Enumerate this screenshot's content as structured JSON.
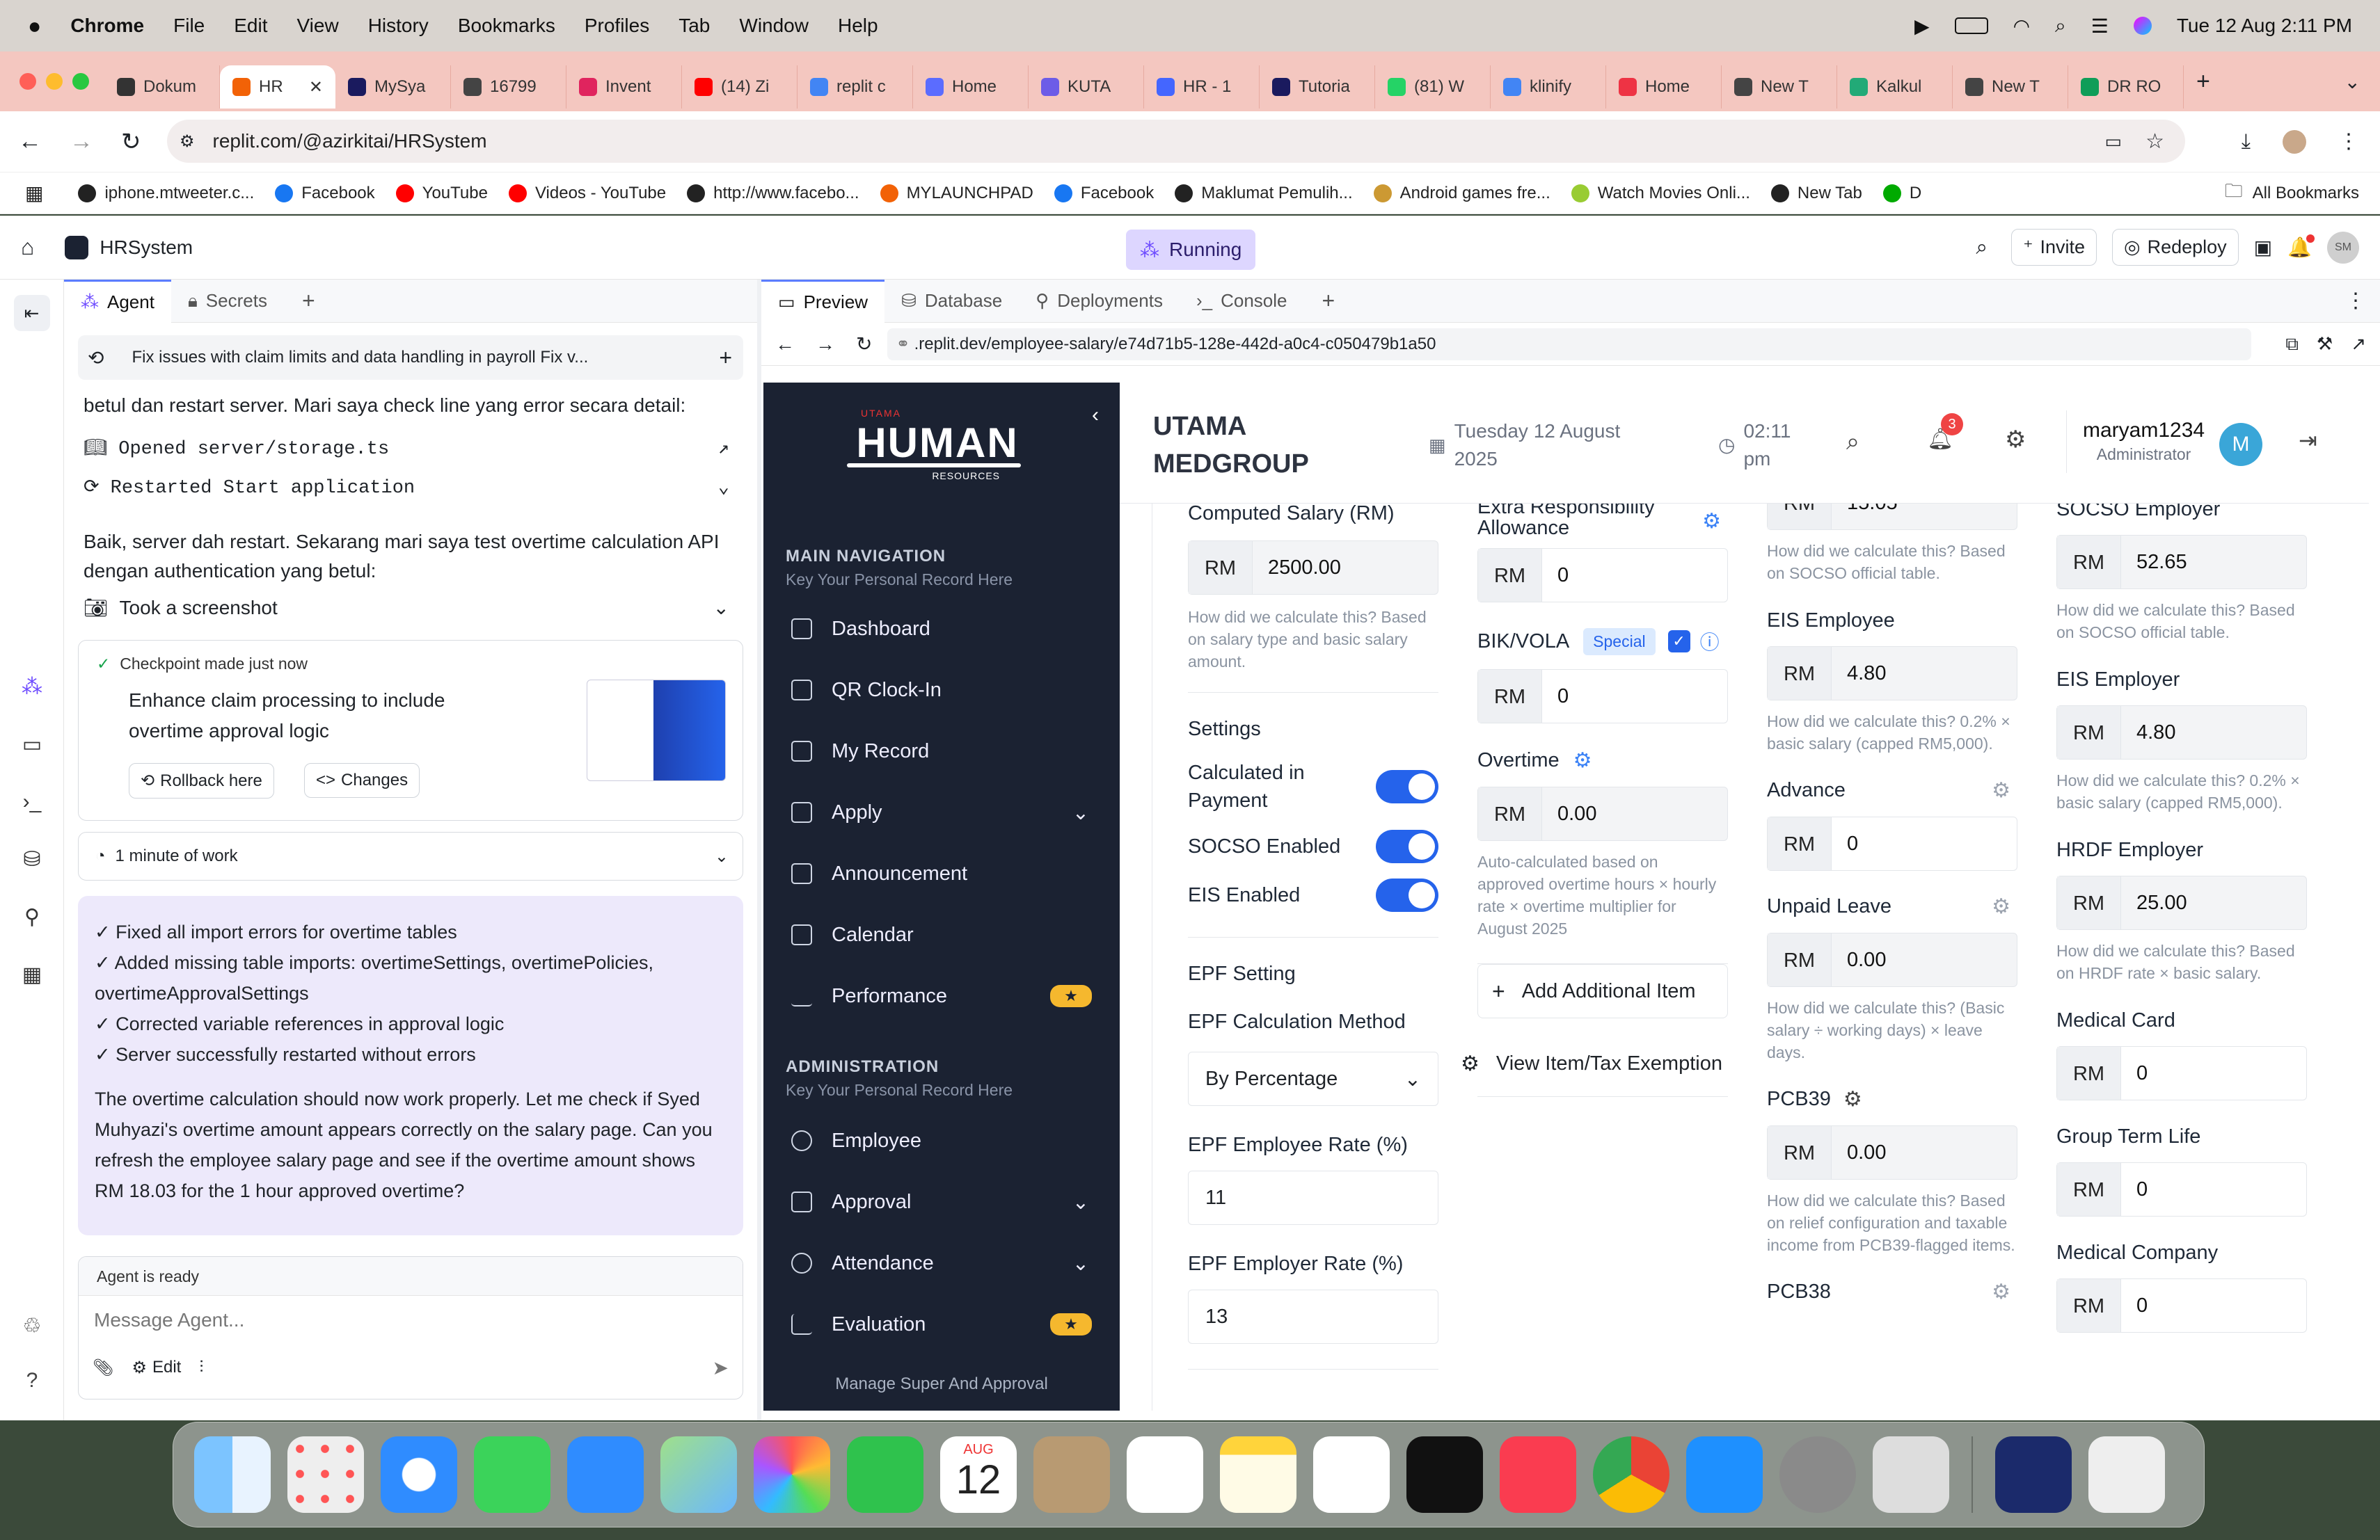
{
  "menubar": {
    "app": "Chrome",
    "items": [
      "File",
      "Edit",
      "View",
      "History",
      "Bookmarks",
      "Profiles",
      "Tab",
      "Window",
      "Help"
    ],
    "datetime": "Tue 12 Aug  2:11 PM"
  },
  "tabs": [
    {
      "label": "Dokum",
      "color": "#333"
    },
    {
      "label": "HR",
      "color": "#f26207"
    },
    {
      "label": "MySya",
      "color": "#1a1a5e"
    },
    {
      "label": "16799",
      "color": "#444"
    },
    {
      "label": "Invent",
      "color": "#e0245e"
    },
    {
      "label": "(14) Zi",
      "color": "#ff0000"
    },
    {
      "label": "replit c",
      "color": "#4285f4"
    },
    {
      "label": "Home",
      "color": "#5b6cff"
    },
    {
      "label": "KUTA",
      "color": "#6c5ce7"
    },
    {
      "label": "HR - 1",
      "color": "#4466ff"
    },
    {
      "label": "Tutoria",
      "color": "#1a1a5e"
    },
    {
      "label": "(81) W",
      "color": "#25d366"
    },
    {
      "label": "klinify",
      "color": "#4285f4"
    },
    {
      "label": "Home",
      "color": "#e34"
    },
    {
      "label": "New T",
      "color": "#444"
    },
    {
      "label": "Kalkul",
      "color": "#2a7"
    },
    {
      "label": "New T",
      "color": "#444"
    },
    {
      "label": "DR RO",
      "color": "#0f9d58"
    }
  ],
  "url": "replit.com/@azirkitai/HRSystem",
  "bookmarks": [
    {
      "label": "iphone.mtweeter.c...",
      "color": "#222"
    },
    {
      "label": "Facebook",
      "color": "#1877f2"
    },
    {
      "label": "YouTube",
      "color": "#ff0000"
    },
    {
      "label": "Videos - YouTube",
      "color": "#ff0000"
    },
    {
      "label": "http://www.facebo...",
      "color": "#222"
    },
    {
      "label": "MYLAUNCHPAD",
      "color": "#f26207"
    },
    {
      "label": "Facebook",
      "color": "#1877f2"
    },
    {
      "label": "Maklumat Pemulih...",
      "color": "#222"
    },
    {
      "label": "Android games fre...",
      "color": "#c93"
    },
    {
      "label": "Watch Movies Onli...",
      "color": "#9c3"
    },
    {
      "label": "New Tab",
      "color": "#222"
    },
    {
      "label": "D",
      "color": "#0a0"
    }
  ],
  "all_bookmarks": "All Bookmarks",
  "replit": {
    "project": "HRSystem",
    "status": "Running",
    "invite": "Invite",
    "redeploy": "Redeploy",
    "avatar": "SM",
    "left_tabs": [
      "Agent",
      "Secrets"
    ],
    "right_tabs": [
      "Preview",
      "Database",
      "Deployments",
      "Console"
    ],
    "preview_url": ".replit.dev/employee-salary/e74d71b5-128e-442d-a0c4-c050479b1a50"
  },
  "agent": {
    "thread_title": "Fix issues with claim limits and data handling in payroll Fix v...",
    "msg1": "betul dan restart server. Mari saya check line yang error secara detail:",
    "act1": "Opened server/storage.ts",
    "act2": "Restarted Start application",
    "msg2": "Baik, server dah restart. Sekarang mari saya test overtime calculation API dengan authentication yang betul:",
    "act3": "Took a screenshot",
    "checkpoint": "Checkpoint made just now",
    "checkpoint_title": "Enhance claim processing to include overtime approval logic",
    "rollback": "Rollback here",
    "changes": "Changes",
    "work": "1 minute of work",
    "bullets": [
      "✓ Fixed all import errors for overtime tables",
      "✓ Added missing table imports: overtimeSettings, overtimePolicies, overtimeApprovalSettings",
      "✓ Corrected variable references in approval logic",
      "✓ Server successfully restarted without errors"
    ],
    "final": "The overtime calculation should now work properly. Let me check if Syed Muhyazi's overtime amount appears correctly on the salary page. Can you refresh the employee salary page and see if the overtime amount shows RM 18.03 for the 1 hour approved overtime?",
    "ready": "Agent is ready",
    "placeholder": "Message Agent...",
    "edit": "Edit"
  },
  "app": {
    "logo_small": "UTAMA",
    "logo": "HUMAN",
    "logo_sub": "RESOURCES",
    "main_nav": "MAIN NAVIGATION",
    "main_sub": "Key Your Personal Record Here",
    "nav": [
      "Dashboard",
      "QR Clock-In",
      "My Record",
      "Apply",
      "Announcement",
      "Calendar",
      "Performance"
    ],
    "admin": "ADMINISTRATION",
    "admin_sub": "Key Your Personal Record Here",
    "admin_nav": [
      "Employee",
      "Approval",
      "Attendance",
      "Evaluation"
    ],
    "footer": "Manage Super And Approval",
    "company1": "UTAMA",
    "company2": "MEDGROUP",
    "date1": "Tuesday 12 August",
    "date2": "2025",
    "time1": "02:11",
    "time2": "pm",
    "notif_count": "3",
    "user": "maryam1234",
    "role": "Administrator",
    "user_initial": "M"
  },
  "form": {
    "rm": "RM",
    "computed_label": "Computed Salary (RM)",
    "computed_value": "2500.00",
    "computed_hint": "How did we calculate this? Based on salary type and basic salary amount.",
    "settings": "Settings",
    "calc_payment": "Calculated in Payment",
    "socso_enabled": "SOCSO Enabled",
    "eis_enabled": "EIS Enabled",
    "epf_setting": "EPF Setting",
    "epf_method_label": "EPF Calculation Method",
    "epf_method": "By Percentage",
    "epf_emp_label": "EPF Employee Rate (%)",
    "epf_emp": "11",
    "epf_er_label": "EPF Employer Rate (%)",
    "epf_er": "13",
    "extra_label": "Extra Responsibility Allowance",
    "extra": "0",
    "bik_label": "BIK/VOLA",
    "special": "Special",
    "bik": "0",
    "ot_label": "Overtime",
    "ot": "0.00",
    "ot_hint": "Auto-calculated based on approved overtime hours × hourly rate × overtime multiplier for August 2025",
    "add_item": "Add Additional Item",
    "view_tax": "View Item/Tax Exemption",
    "socso_emp": "15.05",
    "socso_hint": "How did we calculate this? Based on SOCSO official table.",
    "eis_emp_label": "EIS Employee",
    "eis_emp": "4.80",
    "eis_hint": "How did we calculate this? 0.2% × basic salary (capped RM5,000).",
    "advance_label": "Advance",
    "advance": "0",
    "unpaid_label": "Unpaid Leave",
    "unpaid": "0.00",
    "unpaid_hint": "How did we calculate this? (Basic salary ÷ working days) × leave days.",
    "pcb39_label": "PCB39",
    "pcb39": "0.00",
    "pcb39_hint": "How did we calculate this? Based on relief configuration and taxable income from PCB39-flagged items.",
    "pcb38_label": "PCB38",
    "socso_er_label": "SOCSO Employer",
    "socso_er": "52.65",
    "socso_er_hint": "How did we calculate this? Based on SOCSO official table.",
    "eis_er_label": "EIS Employer",
    "eis_er": "4.80",
    "eis_er_hint": "How did we calculate this? 0.2% × basic salary (capped RM5,000).",
    "hrdf_label": "HRDF Employer",
    "hrdf": "25.00",
    "hrdf_hint": "How did we calculate this? Based on HRDF rate × basic salary.",
    "medcard_label": "Medical Card",
    "medcard": "0",
    "gtl_label": "Group Term Life",
    "gtl": "0",
    "medco_label": "Medical Company",
    "medco": "0"
  },
  "dock": {
    "calendar_month": "AUG",
    "calendar_day": "12"
  }
}
